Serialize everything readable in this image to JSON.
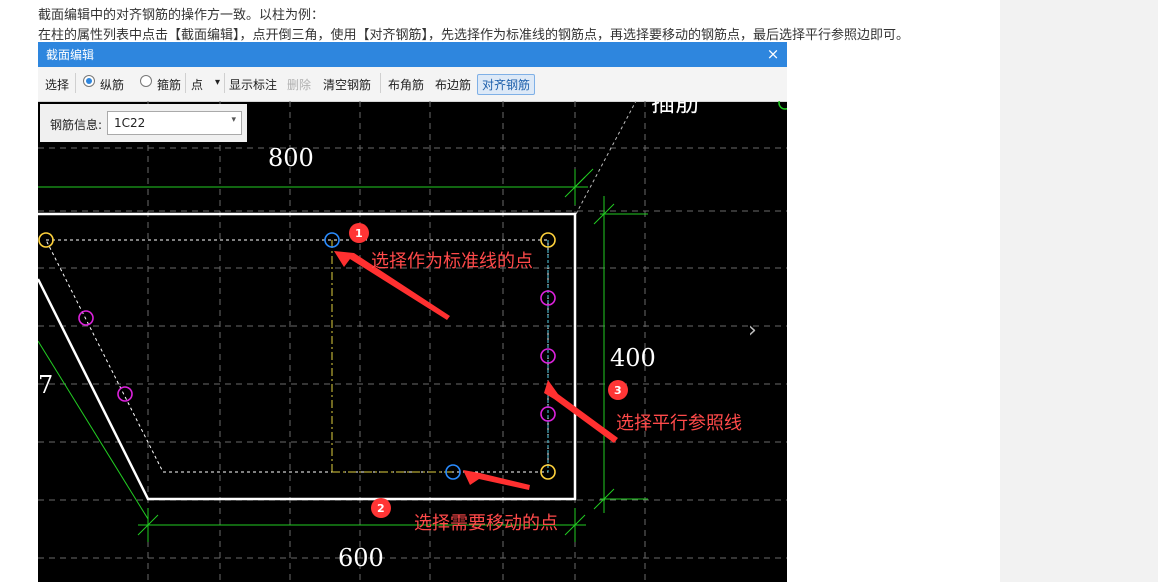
{
  "doc": {
    "line1": "截面编辑中的对齐钢筋的操作方一致。以柱为例：",
    "line2": "在柱的属性列表中点击【截面编辑】，点开倒三角，使用【对齐钢筋】，先选择作为标准线的钢筋点，再选择要移动的钢筋点，最后选择平行参照边即可。"
  },
  "dialog": {
    "title": "截面编辑",
    "close": "×"
  },
  "toolbar": {
    "select": "选择",
    "longitudinal": "纵筋",
    "stirrup": "箍筋",
    "mode": "点",
    "mode_arrow": "▾",
    "show_dims": "显示标注",
    "delete": "删除",
    "clear": "清空钢筋",
    "corner": "布角筋",
    "edge": "布边筋",
    "align": "对齐钢筋",
    "longitudinal_checked": true
  },
  "rebar_info": {
    "label": "钢筋信息:",
    "value": "1C22",
    "arrow": "▾"
  },
  "drawing": {
    "dims": {
      "top": "800",
      "right": "400",
      "bottom": "600",
      "left_partial": "7"
    },
    "partial_label": "插筋",
    "nav_arrow": "›"
  },
  "annotations": [
    {
      "num": "1",
      "text": "选择作为标准线的点"
    },
    {
      "num": "2",
      "text": "选择需要移动的点"
    },
    {
      "num": "3",
      "text": "选择平行参照线"
    }
  ],
  "colors": {
    "title_bar": "#2e86de",
    "canvas": "#000000",
    "outline": "#ffffff",
    "dimension": "#22cc22",
    "rebar_corner": "#ffd23c",
    "rebar_edge": "#dd22dd",
    "rebar_selected": "#2a8cff",
    "annotation": "#ff4a4a"
  }
}
